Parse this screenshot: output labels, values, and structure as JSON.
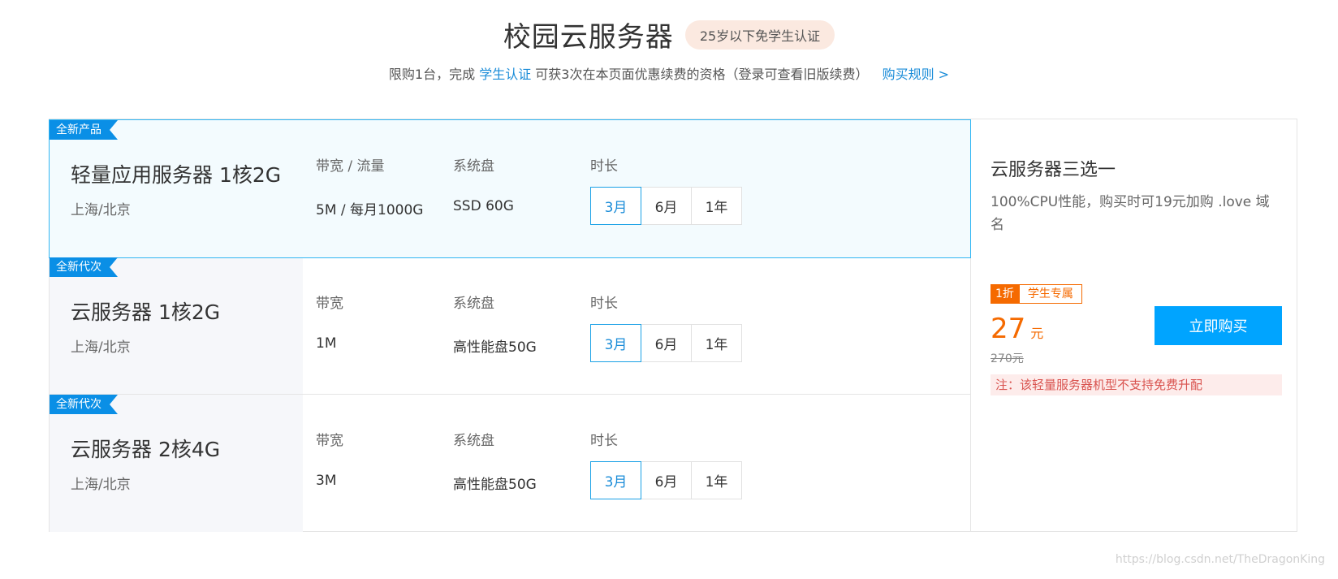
{
  "header": {
    "title": "校园云服务器",
    "badge": "25岁以下免学生认证",
    "subtitle_prefix": "限购1台，完成",
    "student_auth_link": "学生认证",
    "subtitle_suffix": "可获3次在本页面优惠续费的资格（登录可查看旧版续费）",
    "rules_link": "购买规则 >"
  },
  "products": [
    {
      "tag": "全新产品",
      "name": "轻量应用服务器 1核2G",
      "region": "上海/北京",
      "bandwidth_label": "带宽 / 流量",
      "bandwidth_value": "5M / 每月1000G",
      "disk_label": "系统盘",
      "disk_value": "SSD 60G",
      "duration_label": "时长",
      "durations": [
        "3月",
        "6月",
        "1年"
      ],
      "selected_duration": "3月",
      "selected": true
    },
    {
      "tag": "全新代次",
      "name": "云服务器 1核2G",
      "region": "上海/北京",
      "bandwidth_label": "带宽",
      "bandwidth_value": "1M",
      "disk_label": "系统盘",
      "disk_value": "高性能盘50G",
      "duration_label": "时长",
      "durations": [
        "3月",
        "6月",
        "1年"
      ],
      "selected_duration": "3月",
      "selected": false
    },
    {
      "tag": "全新代次",
      "name": "云服务器 2核4G",
      "region": "上海/北京",
      "bandwidth_label": "带宽",
      "bandwidth_value": "3M",
      "disk_label": "系统盘",
      "disk_value": "高性能盘50G",
      "duration_label": "时长",
      "durations": [
        "3月",
        "6月",
        "1年"
      ],
      "selected_duration": "3月",
      "selected": false
    }
  ],
  "side": {
    "title": "云服务器三选一",
    "desc": "100%CPU性能，购买时可19元加购 .love 域名",
    "discount_badge": "1折",
    "student_badge": "学生专属",
    "price": "27",
    "price_unit": "元",
    "original_price": "270元",
    "buy_button": "立即购买",
    "note": "注：该轻量服务器机型不支持免费升配"
  },
  "watermark": "https://blog.csdn.net/TheDragonKing",
  "colors": {
    "accent_blue": "#00a4ff",
    "tag_blue": "#0a8fe6",
    "price_orange": "#f56a00"
  }
}
